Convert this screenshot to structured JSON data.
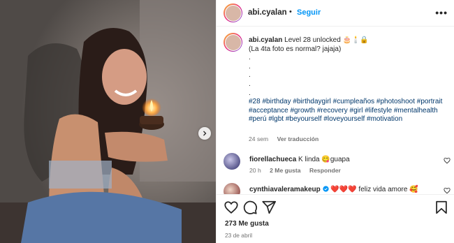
{
  "post": {
    "username": "abi.cyalan",
    "follow_label": "Seguir",
    "more_label": "•••",
    "caption": {
      "username": "abi.cyalan",
      "text_line1": "Level 28 unlocked 🎂🕯️🔒",
      "text_line2": "(La 4ta foto es normal? jajaja)",
      "dots": [
        ".",
        ".",
        ".",
        ".",
        "."
      ],
      "hashtags": [
        "#28",
        "#birthday",
        "#birthdaygirl",
        "#cumpleaños",
        "#photoshoot",
        "#portrait",
        "#acceptance",
        "#growth",
        "#recovery",
        "#girl",
        "#lifestyle",
        "#mentalhealth",
        "#perú",
        "#lgbt",
        "#beyourself",
        "#loveyourself",
        "#motivation"
      ],
      "time": "24 sem",
      "translate_label": "Ver traducción"
    },
    "comments": [
      {
        "username": "fiorellachueca",
        "text": "K linda 😋guapa",
        "time": "20 h",
        "likes": "2 Me gusta",
        "reply_label": "Responder"
      },
      {
        "username": "cynthiavaleramakeup",
        "text": "❤️❤️❤️ feliz vida amore 🥰",
        "verified": true
      }
    ],
    "likes_label": "273 Me gusta",
    "date": "23 de abril"
  },
  "icons": {
    "like": "heart-icon",
    "comment": "comment-icon",
    "share": "share-icon",
    "save": "bookmark-icon",
    "next": "chevron-right-icon",
    "more": "more-icon",
    "verified": "verified-badge-icon"
  },
  "colors": {
    "link": "#0095f6",
    "hashtag": "#00376b",
    "muted": "#737373",
    "text": "#262626"
  }
}
